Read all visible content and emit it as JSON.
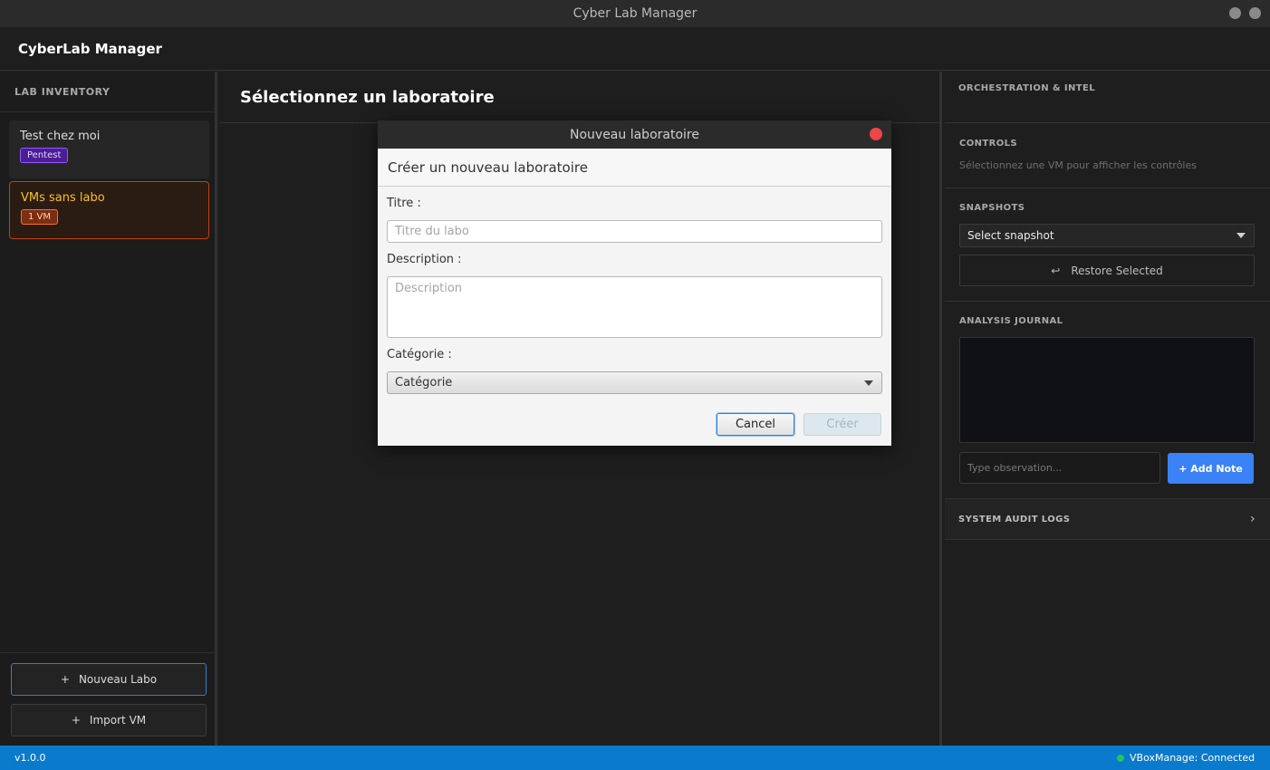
{
  "window": {
    "title": "Cyber Lab Manager"
  },
  "app": {
    "title": "CyberLab Manager"
  },
  "sidebar": {
    "header": "LAB INVENTORY",
    "labs": [
      {
        "name": "Test chez moi",
        "badge": "Pentest"
      },
      {
        "name": "VMs sans labo",
        "badge": "1 VM"
      }
    ],
    "new_lab_icon": "+",
    "new_lab_label": "Nouveau Labo",
    "import_icon": "+",
    "import_label": "Import VM"
  },
  "main": {
    "title": "Sélectionnez un laboratoire"
  },
  "right_panel": {
    "header": "ORCHESTRATION & INTEL",
    "controls": {
      "label": "CONTROLS",
      "hint": "Sélectionnez une VM pour afficher les contrôles"
    },
    "snapshots": {
      "label": "SNAPSHOTS",
      "selected": "Select snapshot",
      "restore_icon": "↩",
      "restore_label": "Restore Selected"
    },
    "journal": {
      "label": "ANALYSIS JOURNAL",
      "input_placeholder": "Type observation...",
      "add_label": "+ Add Note"
    },
    "audit": {
      "label": "SYSTEM AUDIT LOGS",
      "chevron": "›"
    }
  },
  "status": {
    "version": "v1.0.0",
    "connection": "VBoxManage: Connected"
  },
  "dialog": {
    "title": "Nouveau laboratoire",
    "header": "Créer un nouveau laboratoire",
    "title_label": "Titre :",
    "title_placeholder": "Titre du labo",
    "description_label": "Description :",
    "description_placeholder": "Description",
    "category_label": "Catégorie :",
    "category_selected": "Catégorie",
    "cancel_label": "Cancel",
    "create_label": "Créer"
  },
  "colors": {
    "accent": "#3b82f6",
    "statusbar": "#0a7acc",
    "pentest_badge": "#5b21b6",
    "vm_badge": "#92400e",
    "active_lab": "#f59e0b",
    "connected": "#22c55e"
  }
}
